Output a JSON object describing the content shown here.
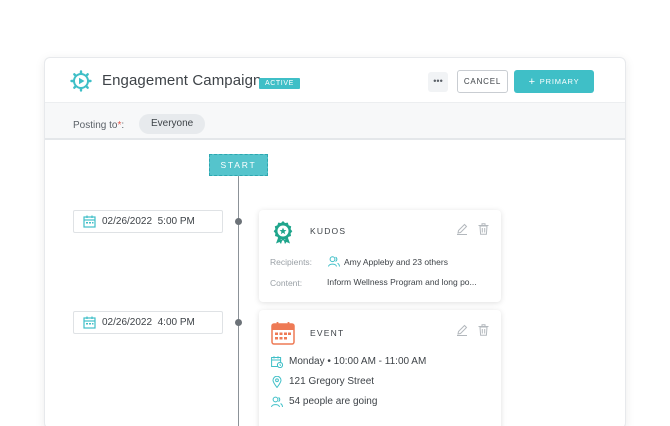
{
  "header": {
    "title": "Engagement Campaign",
    "status_badge": "ACTIVE",
    "more_label": "•••",
    "cancel_label": "CANCEL",
    "primary_label": "PRIMARY",
    "primary_icon": "+"
  },
  "posting": {
    "label": "Posting to",
    "required_mark": "*",
    "suffix": ":",
    "audience": "Everyone"
  },
  "timeline": {
    "start_label": "START",
    "items": [
      {
        "date": "02/26/2022",
        "time": "5:00 PM",
        "type": "KUDOS",
        "recipients_label": "Recipients:",
        "recipients": "Amy Appleby and 23 others",
        "content_label": "Content:",
        "content": "Inform Wellness Program and long po..."
      },
      {
        "date": "02/26/2022",
        "time": "4:00 PM",
        "type": "EVENT",
        "day": "Monday",
        "separator": "•",
        "time_range": "10:00 AM - 11:00 AM",
        "location": "121 Gregory Street",
        "attendance": "54 people are going"
      }
    ]
  },
  "colors": {
    "accent": "#3fbfc7",
    "event_orange": "#ee7a55",
    "kudos_green": "#1fa58c"
  },
  "icons": [
    "campaign-logo-icon",
    "calendar-icon",
    "award-icon",
    "event-calendar-icon",
    "pencil-icon",
    "trash-icon",
    "users-icon",
    "clock-calendar-icon",
    "location-pin-icon",
    "people-icon"
  ]
}
